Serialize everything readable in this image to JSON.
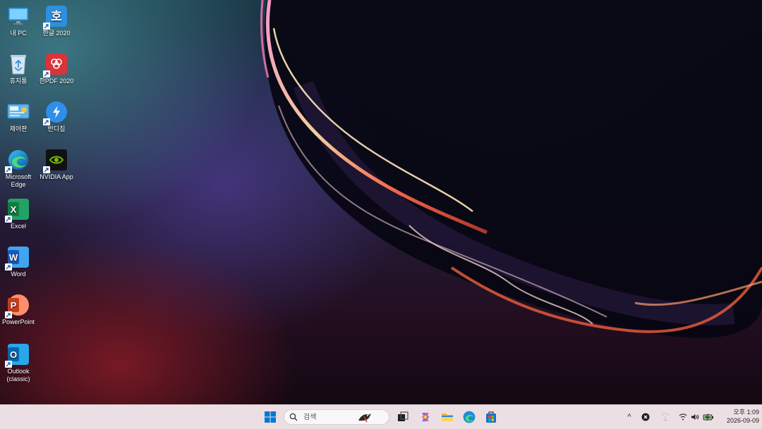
{
  "desktop": {
    "icons": [
      {
        "label": "내 PC",
        "icon": "this-pc-icon",
        "shortcut": false
      },
      {
        "label": "한글 2020",
        "icon": "hangul-2020-icon",
        "shortcut": true,
        "glyph": "호"
      },
      {
        "label": "휴지통",
        "icon": "recycle-bin-icon",
        "shortcut": false
      },
      {
        "label": "한PDF 2020",
        "icon": "hanpdf-2020-icon",
        "shortcut": true
      },
      {
        "label": "제어판",
        "icon": "control-panel-icon",
        "shortcut": false
      },
      {
        "label": "반디집",
        "icon": "bandizip-icon",
        "shortcut": true
      },
      {
        "label": "Microsoft Edge",
        "icon": "edge-icon",
        "shortcut": true
      },
      {
        "label": "NVIDIA App",
        "icon": "nvidia-icon",
        "shortcut": true
      },
      {
        "label": "Excel",
        "icon": "excel-icon",
        "shortcut": true,
        "glyph": "X"
      },
      {
        "label": "Word",
        "icon": "word-icon",
        "shortcut": true,
        "glyph": "W"
      },
      {
        "label": "PowerPoint",
        "icon": "powerpoint-icon",
        "shortcut": true,
        "glyph": "P"
      },
      {
        "label": "Outlook (classic)",
        "icon": "outlook-icon",
        "shortcut": true,
        "glyph": "O"
      }
    ]
  },
  "taskbar": {
    "search_placeholder": "검색",
    "pinned": [
      "start-icon",
      "search-box",
      "task-view-icon",
      "copilot-icon",
      "file-explorer-icon",
      "edge-icon",
      "microsoft-store-icon"
    ],
    "tray": {
      "chevron": "^",
      "clock_line1": "오후 1:09",
      "clock_line2": "2026-09-09"
    }
  },
  "colors": {
    "taskbar_bg": "#ecdfe4",
    "windows_blue": "#0078d4",
    "excel_green": "#1f7a45",
    "word_blue": "#2b5ec5",
    "powerpoint_orange": "#d9482b",
    "outlook_blue": "#0f6cbd"
  }
}
